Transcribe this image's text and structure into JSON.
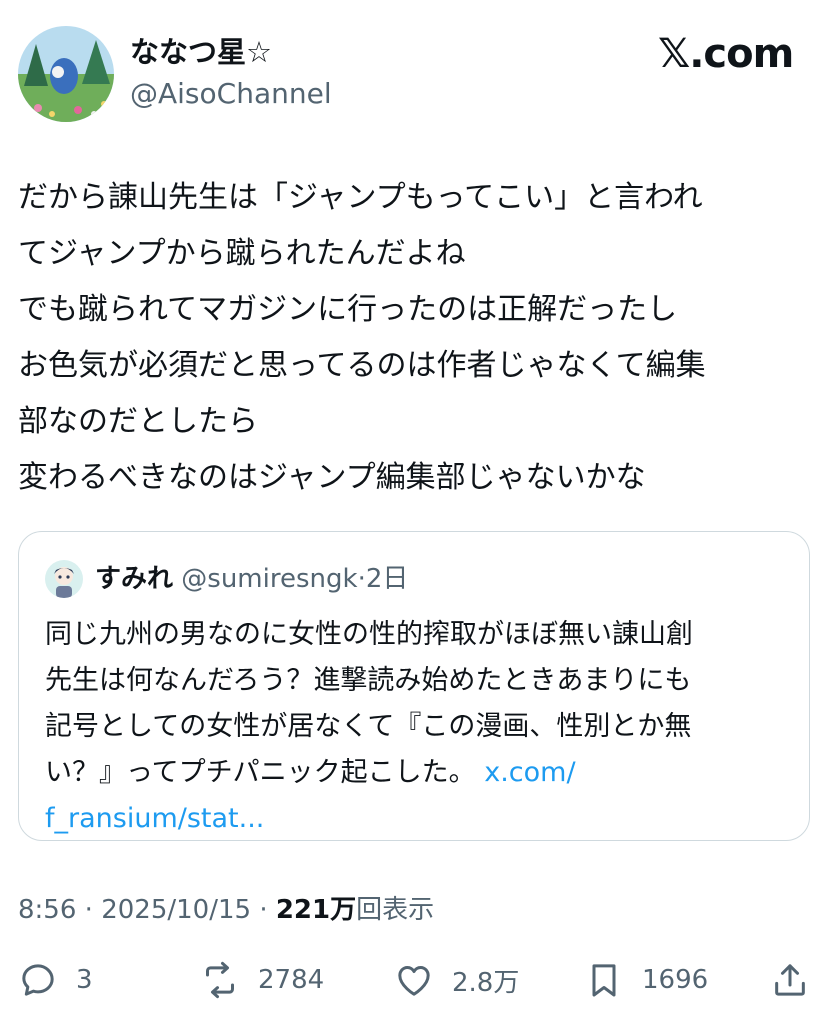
{
  "author": {
    "display_name": "ななつ星☆",
    "handle": "@AisoChannel"
  },
  "brand": "𝕏.com",
  "tweet": {
    "lines": [
      "だから諌山先生は「ジャンプもってこい」と言われ",
      "てジャンプから蹴られたんだよね",
      "でも蹴られてマガジンに行ったのは正解だったし",
      "お色気が必須だと思ってるのは作者じゃなくて編集",
      "部なのだとしたら",
      "変わるべきなのはジャンプ編集部じゃないかな"
    ]
  },
  "quote": {
    "name": "すみれ",
    "handle": "@sumiresngk",
    "separator": "·",
    "time": "2日",
    "lines": [
      "同じ九州の男なのに女性の性的搾取がほぼ無い諌山創",
      "先生は何なんだろう？進撃読み始めたときあまりにも",
      "記号としての女性が居なくて『この漫画、性別とか無",
      "い？』ってプチパニック起こした。"
    ],
    "link_inline": "x.com/",
    "link_continued": "f_ransium/stat..."
  },
  "meta": {
    "time": "8:56",
    "dot1": "·",
    "date": "2025/10/15",
    "dot2": "·",
    "views_count": "221万",
    "views_label": "回表示"
  },
  "actions": {
    "replies": "3",
    "retweets": "2784",
    "likes": "2.8万",
    "bookmarks": "1696"
  },
  "colors": {
    "text": "#0f1419",
    "secondary": "#536471",
    "link": "#1d9bf0",
    "border": "#cfd9de"
  },
  "icons": {
    "reply": "reply-icon",
    "retweet": "retweet-icon",
    "like": "heart-icon",
    "bookmark": "bookmark-icon",
    "share": "share-icon"
  }
}
